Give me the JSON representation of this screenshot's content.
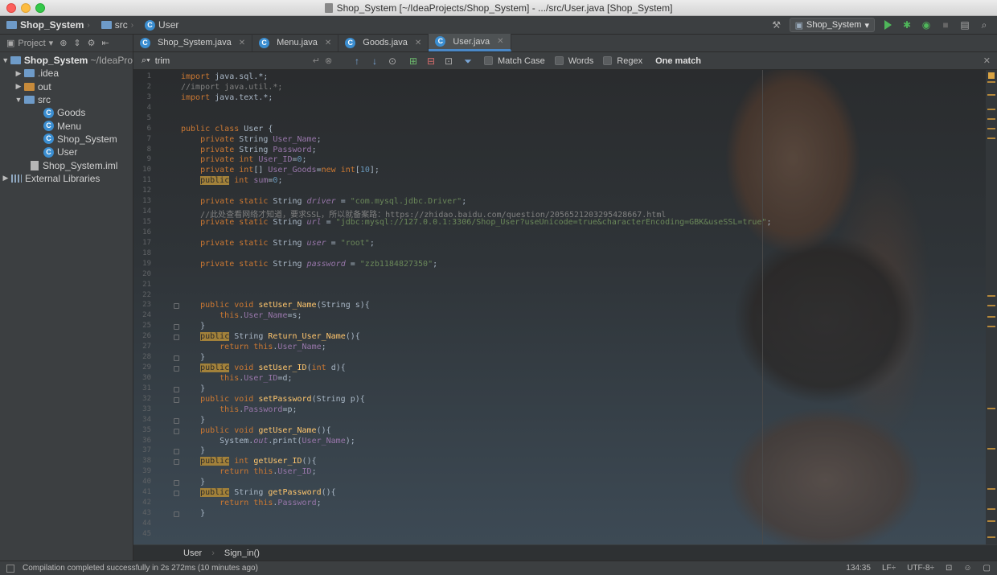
{
  "window": {
    "title": "Shop_System [~/IdeaProjects/Shop_System] - .../src/User.java [Shop_System]"
  },
  "navbar": {
    "breadcrumbs": [
      "Shop_System",
      "src",
      "User"
    ],
    "run_config": "Shop_System"
  },
  "project_panel": {
    "header": "Project",
    "tree": [
      {
        "label": "Shop_System",
        "suffix": "~/IdeaPro",
        "level": 0,
        "expanded": true,
        "kind": "module"
      },
      {
        "label": ".idea",
        "level": 1,
        "expanded": false,
        "kind": "folder"
      },
      {
        "label": "out",
        "level": 1,
        "expanded": false,
        "kind": "folder-orange"
      },
      {
        "label": "src",
        "level": 1,
        "expanded": true,
        "kind": "folder"
      },
      {
        "label": "Goods",
        "level": 2,
        "kind": "class"
      },
      {
        "label": "Menu",
        "level": 2,
        "kind": "class"
      },
      {
        "label": "Shop_System",
        "level": 2,
        "kind": "class"
      },
      {
        "label": "User",
        "level": 2,
        "kind": "class"
      },
      {
        "label": "Shop_System.iml",
        "level": 1,
        "kind": "iml"
      },
      {
        "label": "External Libraries",
        "level": 0,
        "expanded": false,
        "kind": "library"
      }
    ]
  },
  "tabs": [
    {
      "label": "Shop_System.java",
      "active": false
    },
    {
      "label": "Menu.java",
      "active": false
    },
    {
      "label": "Goods.java",
      "active": false
    },
    {
      "label": "User.java",
      "active": true
    }
  ],
  "search": {
    "query": "trim",
    "options": [
      "Match Case",
      "Words",
      "Regex"
    ],
    "result": "One match"
  },
  "editor": {
    "line_numbers": [
      "1",
      "2",
      "3",
      "4",
      "5",
      "6",
      "7",
      "8",
      "9",
      "10",
      "11",
      "12",
      "13",
      "14",
      "15",
      "16",
      "17",
      "18",
      "19",
      "20",
      "21",
      "22",
      "23",
      "24",
      "25",
      "26",
      "27",
      "28",
      "29",
      "30",
      "31",
      "32",
      "33",
      "34",
      "35",
      "36",
      "37",
      "38",
      "39",
      "40",
      "41",
      "42",
      "43",
      "44",
      "45"
    ],
    "lines": [
      [
        {
          "t": "import ",
          "c": "kw"
        },
        {
          "t": "java.sql.*;"
        }
      ],
      [
        {
          "t": "//import java.util.*;",
          "c": "cmt"
        }
      ],
      [
        {
          "t": "import ",
          "c": "kw"
        },
        {
          "t": "java.text.*;"
        }
      ],
      [],
      [],
      [
        {
          "t": "public class ",
          "c": "kw"
        },
        {
          "t": "User {"
        }
      ],
      [
        {
          "t": "    private ",
          "c": "kw"
        },
        {
          "t": "String "
        },
        {
          "t": "User_Name",
          "c": "fld"
        },
        {
          "t": ";"
        }
      ],
      [
        {
          "t": "    private ",
          "c": "kw"
        },
        {
          "t": "String "
        },
        {
          "t": "Password",
          "c": "fld"
        },
        {
          "t": ";"
        }
      ],
      [
        {
          "t": "    private int ",
          "c": "kw"
        },
        {
          "t": "User_ID",
          "c": "fld"
        },
        {
          "t": "="
        },
        {
          "t": "0",
          "c": "num"
        },
        {
          "t": ";"
        }
      ],
      [
        {
          "t": "    private int",
          "c": "kw"
        },
        {
          "t": "[] "
        },
        {
          "t": "User_Goods",
          "c": "fld"
        },
        {
          "t": "="
        },
        {
          "t": "new int",
          "c": "kw"
        },
        {
          "t": "["
        },
        {
          "t": "10",
          "c": "num"
        },
        {
          "t": "];"
        }
      ],
      [
        {
          "t": "    "
        },
        {
          "t": "public",
          "c": "hl"
        },
        {
          "t": " int ",
          "c": "kw"
        },
        {
          "t": "sum",
          "c": "fld"
        },
        {
          "t": "="
        },
        {
          "t": "0",
          "c": "num"
        },
        {
          "t": ";"
        }
      ],
      [],
      [
        {
          "t": "    private static ",
          "c": "kw"
        },
        {
          "t": "String "
        },
        {
          "t": "driver",
          "c": "fld it"
        },
        {
          "t": " = "
        },
        {
          "t": "\"com.mysql.jdbc.Driver\"",
          "c": "str"
        },
        {
          "t": ";"
        }
      ],
      [
        {
          "t": "    //此处查看网络才知道，要求SSL，所以就备案路：https://zhidao.baidu.com/question/2056521203295428667.html",
          "c": "cmt"
        }
      ],
      [
        {
          "t": "    private static ",
          "c": "kw"
        },
        {
          "t": "String "
        },
        {
          "t": "url",
          "c": "fld it"
        },
        {
          "t": " = "
        },
        {
          "t": "\"jdbc:mysql://127.0.0.1:3306/Shop_User?useUnicode=true&characterEncoding=GBK&useSSL=true\"",
          "c": "str"
        },
        {
          "t": ";"
        }
      ],
      [],
      [
        {
          "t": "    private static ",
          "c": "kw"
        },
        {
          "t": "String "
        },
        {
          "t": "user",
          "c": "fld it"
        },
        {
          "t": " = "
        },
        {
          "t": "\"root\"",
          "c": "str"
        },
        {
          "t": ";"
        }
      ],
      [],
      [
        {
          "t": "    private static ",
          "c": "kw"
        },
        {
          "t": "String "
        },
        {
          "t": "password",
          "c": "fld it"
        },
        {
          "t": " = "
        },
        {
          "t": "\"zzb1184827350\"",
          "c": "str"
        },
        {
          "t": ";"
        }
      ],
      [],
      [],
      [],
      [
        {
          "t": "    public void ",
          "c": "kw"
        },
        {
          "t": "setUser_Name",
          "c": "fn"
        },
        {
          "t": "(String s){"
        }
      ],
      [
        {
          "t": "        this",
          "c": "kw"
        },
        {
          "t": "."
        },
        {
          "t": "User_Name",
          "c": "fld"
        },
        {
          "t": "=s;"
        }
      ],
      [
        {
          "t": "    }"
        }
      ],
      [
        {
          "t": "    "
        },
        {
          "t": "public",
          "c": "hl"
        },
        {
          "t": " "
        },
        {
          "t": "String "
        },
        {
          "t": "Return_User_Name",
          "c": "fn"
        },
        {
          "t": "(){"
        }
      ],
      [
        {
          "t": "        return this",
          "c": "kw"
        },
        {
          "t": "."
        },
        {
          "t": "User_Name",
          "c": "fld"
        },
        {
          "t": ";"
        }
      ],
      [
        {
          "t": "    }"
        }
      ],
      [
        {
          "t": "    "
        },
        {
          "t": "public",
          "c": "hl"
        },
        {
          "t": " void ",
          "c": "kw"
        },
        {
          "t": "setUser_ID",
          "c": "fn"
        },
        {
          "t": "("
        },
        {
          "t": "int ",
          "c": "kw"
        },
        {
          "t": "d){"
        }
      ],
      [
        {
          "t": "        this",
          "c": "kw"
        },
        {
          "t": "."
        },
        {
          "t": "User_ID",
          "c": "fld"
        },
        {
          "t": "=d;"
        }
      ],
      [
        {
          "t": "    }"
        }
      ],
      [
        {
          "t": "    public void ",
          "c": "kw"
        },
        {
          "t": "setPassword",
          "c": "fn"
        },
        {
          "t": "(String p){"
        }
      ],
      [
        {
          "t": "        this",
          "c": "kw"
        },
        {
          "t": "."
        },
        {
          "t": "Password",
          "c": "fld"
        },
        {
          "t": "=p;"
        }
      ],
      [
        {
          "t": "    }"
        }
      ],
      [
        {
          "t": "    public void ",
          "c": "kw"
        },
        {
          "t": "getUser_Name",
          "c": "fn"
        },
        {
          "t": "(){"
        }
      ],
      [
        {
          "t": "        System."
        },
        {
          "t": "out",
          "c": "fld it"
        },
        {
          "t": ".print("
        },
        {
          "t": "User_Name",
          "c": "fld"
        },
        {
          "t": ");"
        }
      ],
      [
        {
          "t": "    }"
        }
      ],
      [
        {
          "t": "    "
        },
        {
          "t": "public",
          "c": "hl"
        },
        {
          "t": " int ",
          "c": "kw"
        },
        {
          "t": "getUser_ID",
          "c": "fn"
        },
        {
          "t": "(){"
        }
      ],
      [
        {
          "t": "        return this",
          "c": "kw"
        },
        {
          "t": "."
        },
        {
          "t": "User_ID",
          "c": "fld"
        },
        {
          "t": ";"
        }
      ],
      [
        {
          "t": "    }"
        }
      ],
      [
        {
          "t": "    "
        },
        {
          "t": "public",
          "c": "hl"
        },
        {
          "t": " "
        },
        {
          "t": "String "
        },
        {
          "t": "getPassword",
          "c": "fn"
        },
        {
          "t": "(){"
        }
      ],
      [
        {
          "t": "        return this",
          "c": "kw"
        },
        {
          "t": "."
        },
        {
          "t": "Password",
          "c": "fld"
        },
        {
          "t": ";"
        }
      ],
      [
        {
          "t": "    }"
        }
      ],
      [],
      []
    ]
  },
  "breadcrumbs_bottom": [
    "User",
    "Sign_in()"
  ],
  "status": {
    "message": "Compilation completed successfully in 2s 272ms (10 minutes ago)",
    "position": "134:35",
    "line_sep": "LF÷",
    "encoding": "UTF-8÷"
  },
  "colors": {
    "keyword": "#cc7832",
    "field": "#9876aa",
    "string": "#6a8759",
    "number": "#6897bb",
    "method": "#ffc66d",
    "highlight": "#a2813a",
    "accent": "#4a88c7"
  }
}
